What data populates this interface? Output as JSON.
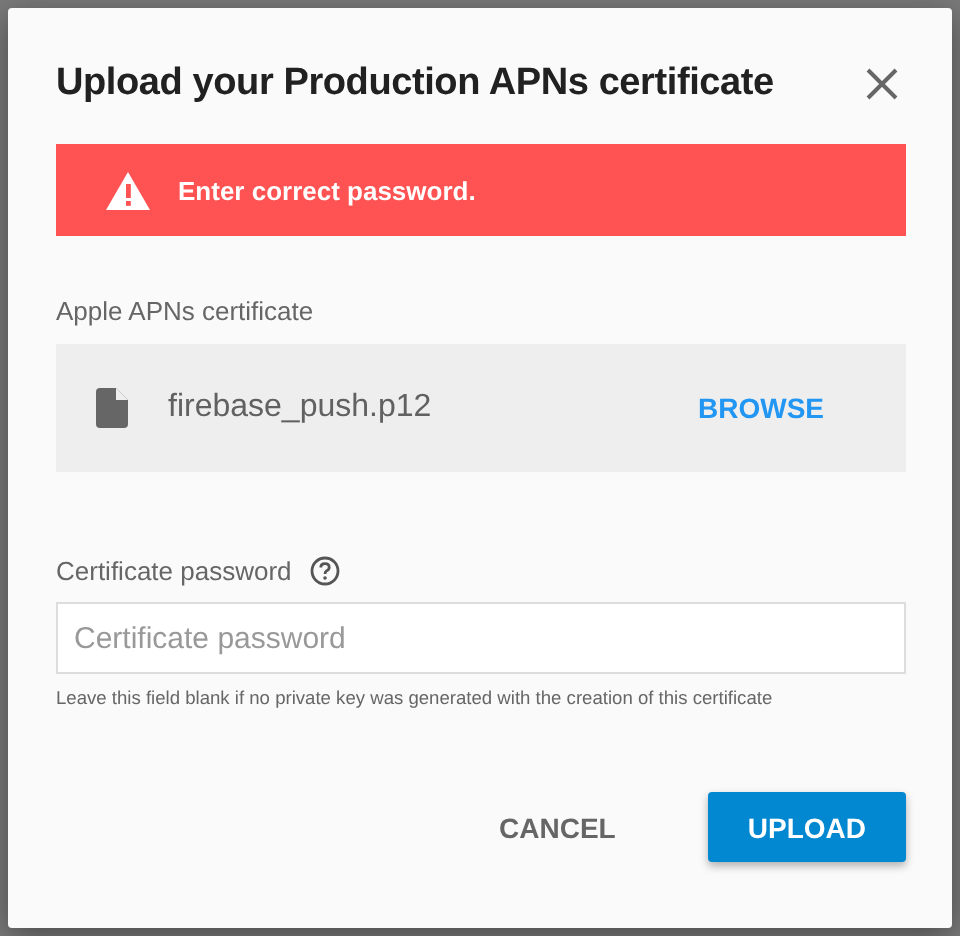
{
  "dialog": {
    "title": "Upload your Production APNs certificate",
    "alert": {
      "kind": "error",
      "message": "Enter correct password."
    },
    "certificate": {
      "label": "Apple APNs certificate",
      "file_name": "firebase_push.p12",
      "browse": "BROWSE"
    },
    "password": {
      "label": "Certificate password",
      "placeholder": "Certificate password",
      "hint": "Leave this field blank if no private key was generated with the creation of this certificate"
    },
    "buttons": [
      {
        "label": "CANCEL",
        "kind": "flat"
      },
      {
        "label": "UPLOAD",
        "kind": "raised"
      }
    ]
  }
}
